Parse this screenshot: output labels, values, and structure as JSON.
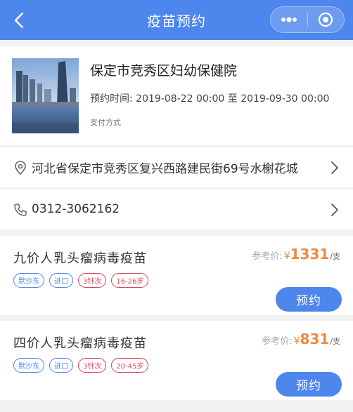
{
  "nav": {
    "title": "疫苗预约",
    "more_icon": "more-dots-icon",
    "close_icon": "target-circle-icon",
    "bg_color": "#4d86ed"
  },
  "hospital": {
    "name": "保定市竞秀区妇幼保健院",
    "time_label": "预约时间: 2019-08-22 00:00 至 2019-09-30 00:00",
    "payment_label": "支付方式"
  },
  "address": {
    "text": "河北省保定市竞秀区复兴西路建民街69号水榭花城",
    "icon": "location-pin-icon"
  },
  "phone": {
    "text": "0312-3062162",
    "icon": "phone-icon"
  },
  "vaccines": [
    {
      "name": "九价人乳头瘤病毒疫苗",
      "tags": [
        "默沙东",
        "进口",
        "3针次",
        "16-26岁"
      ],
      "price_label": "参考价:",
      "currency": "¥",
      "price": "1331",
      "unit": "/支",
      "button": "预约"
    },
    {
      "name": "四价人乳头瘤病毒疫苗",
      "tags": [
        "默沙东",
        "进口",
        "3针次",
        "20-45岁"
      ],
      "price_label": "参考价:",
      "currency": "¥",
      "price": "831",
      "unit": "/支",
      "button": "预约"
    }
  ],
  "colors": {
    "accent": "#4d86ed",
    "price": "#f0883e",
    "tag_red": "#d9405a"
  }
}
